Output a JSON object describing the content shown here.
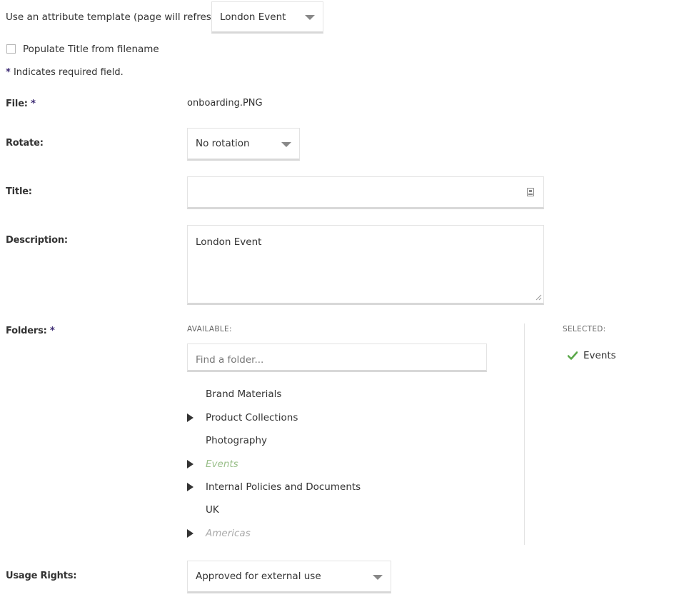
{
  "template": {
    "label": "Use an attribute template (page will refresh):",
    "selected": "London Event"
  },
  "populate_title": {
    "label": "Populate Title from filename",
    "checked": false
  },
  "required_note": {
    "star": "*",
    "text": "Indicates required field."
  },
  "file": {
    "label": "File:",
    "required_star": "*",
    "value": "onboarding.PNG"
  },
  "rotate": {
    "label": "Rotate:",
    "selected": "No rotation"
  },
  "title_field": {
    "label": "Title:",
    "value": "",
    "icon": "contact-card-icon"
  },
  "description": {
    "label": "Description:",
    "value": "London Event"
  },
  "folders": {
    "label": "Folders:",
    "required_star": "*",
    "available_heading": "AVAILABLE:",
    "selected_heading": "SELECTED:",
    "search_placeholder": "Find a folder...",
    "tree": [
      {
        "label": "Brand Materials",
        "expandable": false,
        "state": "normal"
      },
      {
        "label": "Product Collections",
        "expandable": true,
        "state": "normal"
      },
      {
        "label": "Photography",
        "expandable": false,
        "state": "normal"
      },
      {
        "label": "Events",
        "expandable": true,
        "state": "selected"
      },
      {
        "label": "Internal Policies and Documents",
        "expandable": true,
        "state": "normal"
      },
      {
        "label": "UK",
        "expandable": false,
        "state": "normal"
      },
      {
        "label": "Americas",
        "expandable": true,
        "state": "muted"
      }
    ],
    "selected_items": [
      {
        "label": "Events",
        "icon": "checkmark-icon"
      }
    ]
  },
  "usage_rights": {
    "label": "Usage Rights:",
    "selected": "Approved for external use"
  },
  "colors": {
    "required_star": "#3c2a73",
    "selected_folder": "#9bc08b",
    "checkmark": "#5ba84a",
    "muted_folder": "#aaaaaa"
  }
}
